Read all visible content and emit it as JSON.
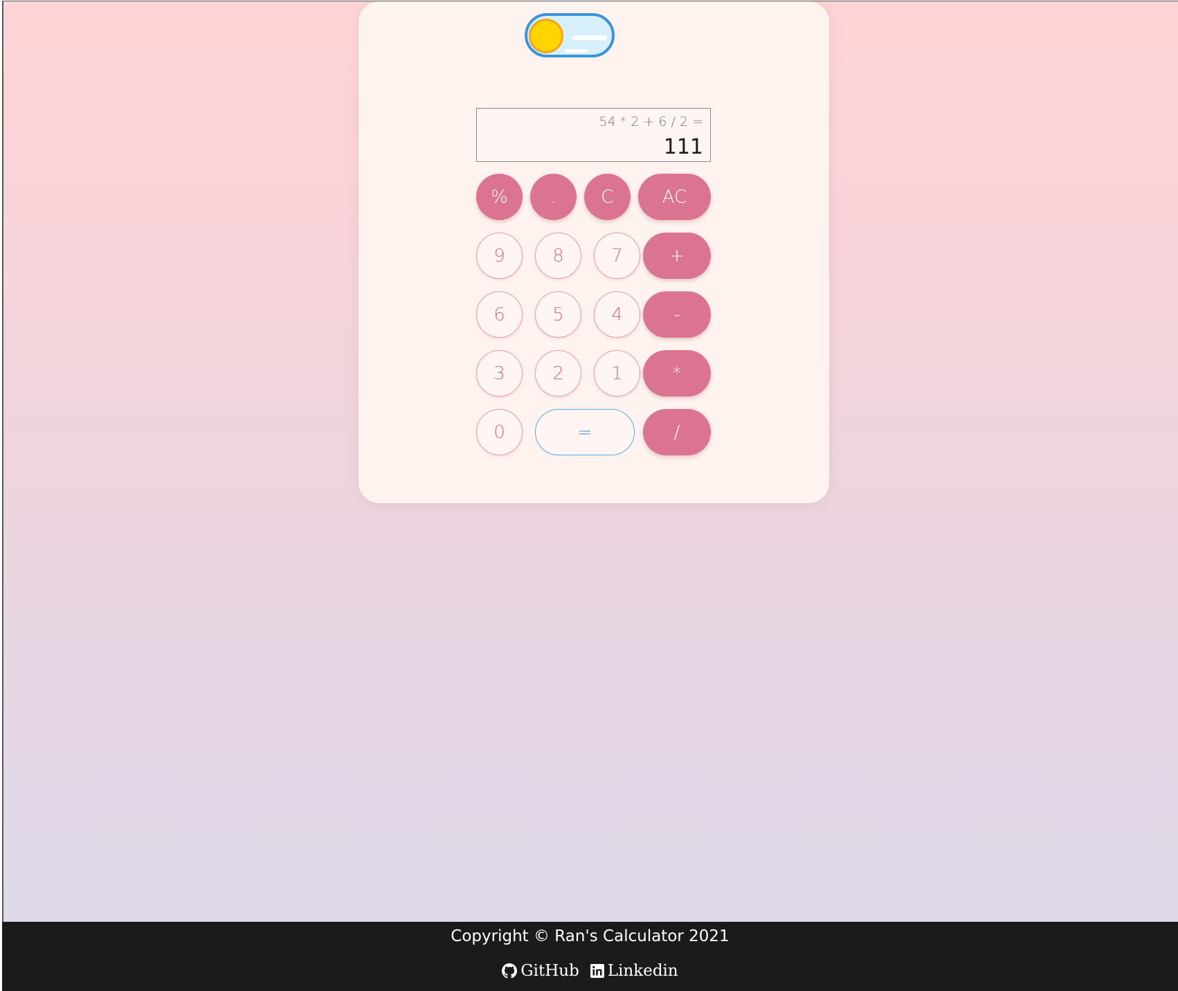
{
  "display": {
    "expression": "54 * 2 + 6 / 2 =",
    "result": "111"
  },
  "theme_toggle": {
    "state": "light",
    "icon": "sun-icon"
  },
  "buttons": {
    "percent": "%",
    "dot": ".",
    "clear": "C",
    "all_clear": "AC",
    "nine": "9",
    "eight": "8",
    "seven": "7",
    "plus": "+",
    "six": "6",
    "five": "5",
    "four": "4",
    "minus": "-",
    "three": "3",
    "two": "2",
    "one": "1",
    "multiply": "*",
    "zero": "0",
    "equals": "=",
    "divide": "/"
  },
  "footer": {
    "copyright": "Copyright © Ran's Calculator 2021",
    "github_label": "GitHub",
    "github_icon": "github-icon",
    "linkedin_label": "Linkedin",
    "linkedin_icon": "linkedin-icon"
  },
  "colors": {
    "accent_pink": "#db7393",
    "toggle_blue": "#3b93d8",
    "sun_yellow": "#ffd400",
    "card_bg": "#fff3ef",
    "footer_bg": "#1b1b1b"
  }
}
